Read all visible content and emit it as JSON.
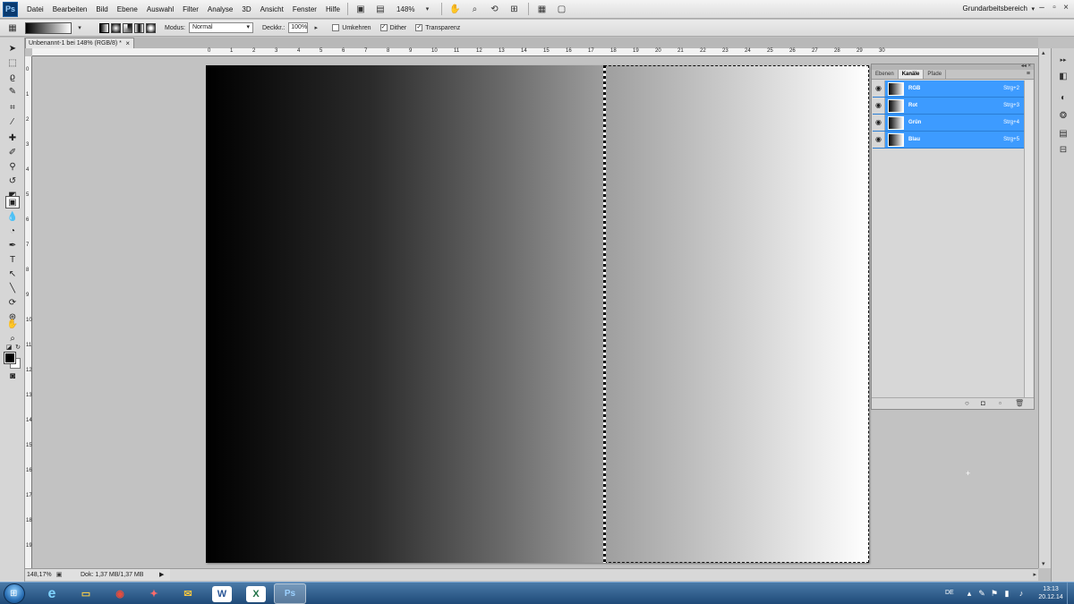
{
  "app": {
    "logo": "Ps",
    "workspace": "Grundarbeitsbereich",
    "zoom_display": "148%"
  },
  "menu": [
    "Datei",
    "Bearbeiten",
    "Bild",
    "Ebene",
    "Auswahl",
    "Filter",
    "Analyse",
    "3D",
    "Ansicht",
    "Fenster",
    "Hilfe"
  ],
  "options": {
    "mode_label": "Modus:",
    "mode_value": "Normal",
    "opacity_label": "Deckkr.:",
    "opacity_value": "100%",
    "reverse_label": "Umkehren",
    "reverse_checked": false,
    "dither_label": "Dither",
    "dither_checked": true,
    "transparency_label": "Transparenz",
    "transparency_checked": true
  },
  "document": {
    "tab_title": "Unbenannt-1 bei 148% (RGB/8) *",
    "close_glyph": "×",
    "gradient_colors": [
      "#000000",
      "#ffffff"
    ]
  },
  "ruler": {
    "top_labels": [
      "0",
      "1",
      "2",
      "3",
      "4",
      "5",
      "6",
      "7",
      "8",
      "9",
      "10",
      "11",
      "12",
      "13",
      "14",
      "15",
      "16",
      "17",
      "18",
      "19",
      "20",
      "21",
      "22",
      "23",
      "24",
      "25",
      "26",
      "27",
      "28",
      "29",
      "30"
    ],
    "left_labels": [
      "0",
      "1",
      "2",
      "3",
      "4",
      "5",
      "6",
      "7",
      "8",
      "9",
      "10",
      "11",
      "12",
      "13",
      "14",
      "15",
      "16",
      "17",
      "18",
      "19"
    ]
  },
  "status": {
    "zoom": "148,17%",
    "doc_info": "Dok: 1,37 MB/1,37 MB"
  },
  "panel": {
    "tabs": [
      "Ebenen",
      "Kanäle",
      "Pfade"
    ],
    "active_tab": "Kanäle",
    "channels": [
      {
        "name": "RGB",
        "shortcut": "Strg+2"
      },
      {
        "name": "Rot",
        "shortcut": "Strg+3"
      },
      {
        "name": "Grün",
        "shortcut": "Strg+4"
      },
      {
        "name": "Blau",
        "shortcut": "Strg+5"
      }
    ],
    "selected_color": "#3d9bff"
  },
  "taskbar": {
    "language": "DE",
    "time": "13:13",
    "date": "20.12.14",
    "apps": [
      {
        "icon": "internet-explorer-icon",
        "glyph": "e"
      },
      {
        "icon": "file-explorer-icon",
        "glyph": "▭"
      },
      {
        "icon": "chrome-icon",
        "glyph": "◉"
      },
      {
        "icon": "acrobat-icon",
        "glyph": "✦"
      },
      {
        "icon": "outlook-icon",
        "glyph": "✉"
      },
      {
        "icon": "word-icon",
        "glyph": "W"
      },
      {
        "icon": "excel-icon",
        "glyph": "X"
      },
      {
        "icon": "photoshop-icon",
        "glyph": "Ps"
      }
    ]
  }
}
